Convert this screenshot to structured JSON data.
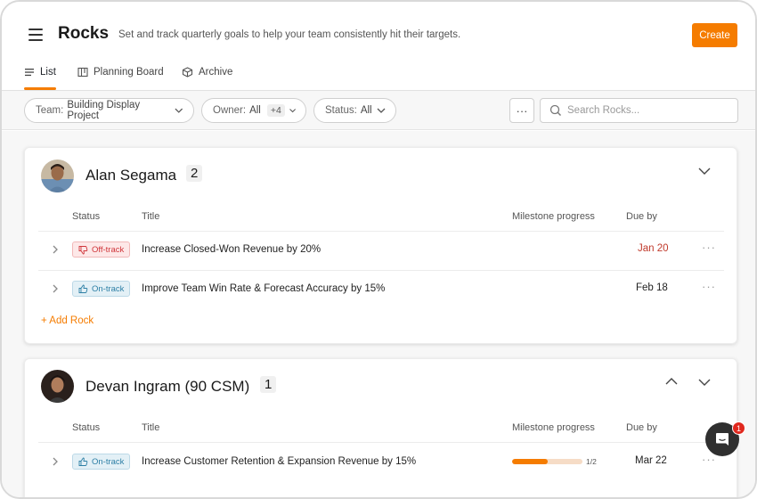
{
  "header": {
    "title": "Rocks",
    "subtitle": "Set and track quarterly goals to help your team consistently hit their targets.",
    "create_label": "Create"
  },
  "tabs": [
    {
      "label": "List",
      "icon": "list-icon",
      "active": true
    },
    {
      "label": "Planning Board",
      "icon": "board-icon",
      "active": false
    },
    {
      "label": "Archive",
      "icon": "archive-icon",
      "active": false
    }
  ],
  "filters": {
    "team": {
      "label": "Team:",
      "value": "Building Display Project"
    },
    "owner": {
      "label": "Owner:",
      "value": "All",
      "extra": "+4"
    },
    "status": {
      "label": "Status:",
      "value": "All"
    },
    "more_label": "···",
    "search_placeholder": "Search Rocks..."
  },
  "columns": {
    "status": "Status",
    "title": "Title",
    "milestone": "Milestone progress",
    "due": "Due by"
  },
  "groups": [
    {
      "owner": "Alan Segama",
      "count": "2",
      "rocks": [
        {
          "status": "Off-track",
          "title": "Increase Closed-Won Revenue by 20%",
          "due": "Jan 20",
          "overdue": true
        },
        {
          "status": "On-track",
          "title": "Improve Team Win Rate & Forecast Accuracy by 15%",
          "due": "Feb 18",
          "overdue": false
        }
      ],
      "add_label": "+ Add Rock"
    },
    {
      "owner": "Devan Ingram (90 CSM)",
      "count": "1",
      "rocks": [
        {
          "status": "On-track",
          "title": "Increase Customer Retention & Expansion Revenue by 15%",
          "due": "Mar 22",
          "progress_label": "1/2",
          "progress": 0.5
        }
      ]
    }
  ],
  "chat": {
    "badge": "1"
  },
  "colors": {
    "accent": "#f57c00",
    "off_track": "#d0363b",
    "on_track": "#2d7fa5"
  }
}
